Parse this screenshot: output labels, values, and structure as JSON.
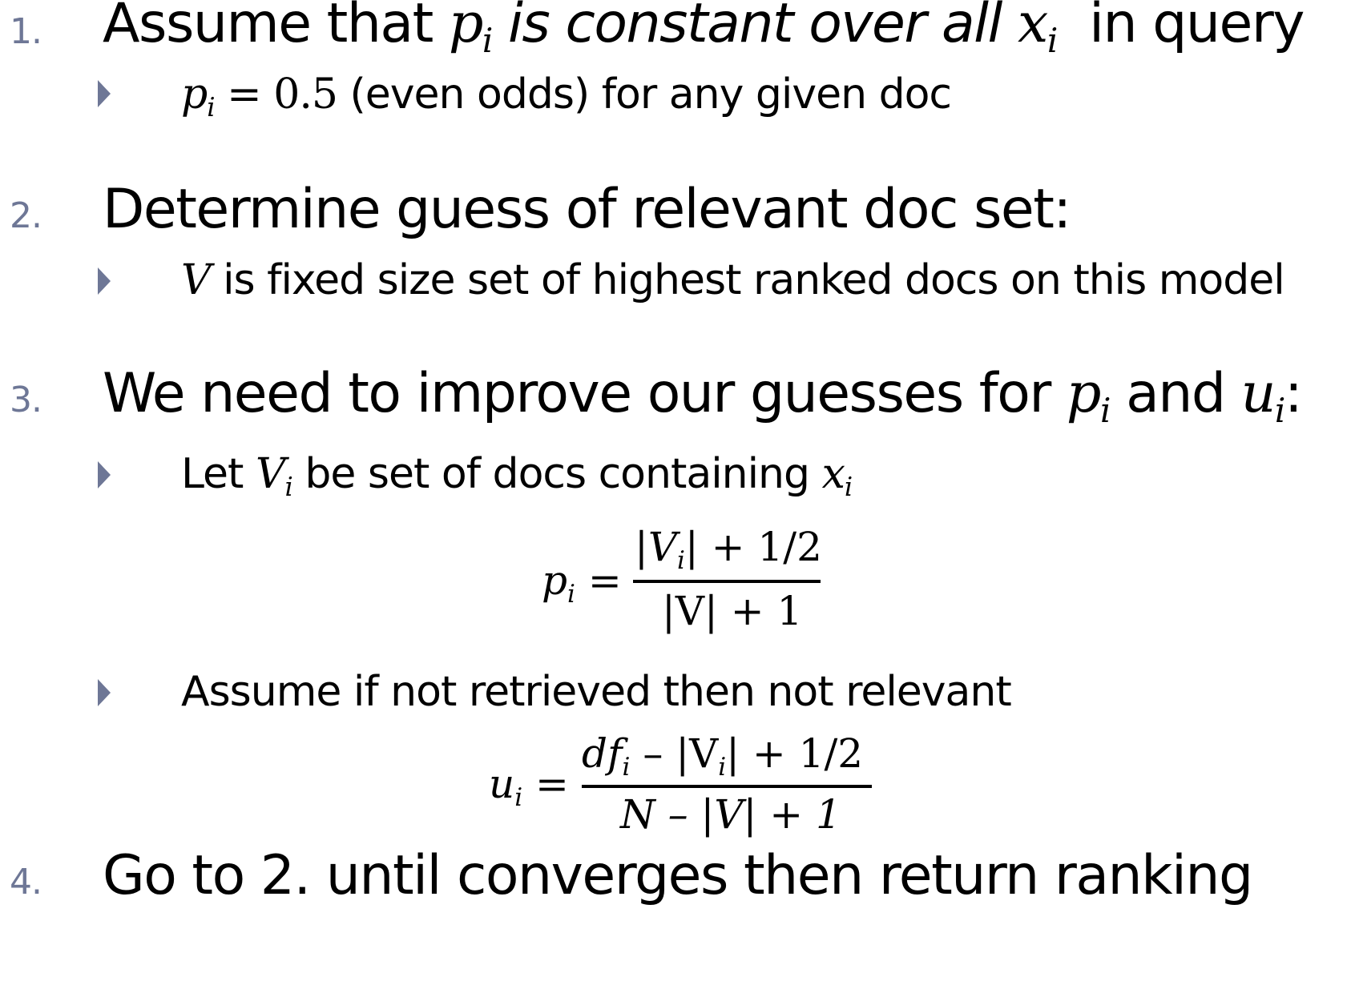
{
  "steps": [
    {
      "number": "1.",
      "text_a": "Assume that",
      "var_p": "p",
      "sub_i": "i",
      "text_b": "is constant over all",
      "var_x": "x",
      "text_c": "in query",
      "bullet": {
        "var_p": "p",
        "sub_i": "i",
        "eq": "= 0.5",
        "text": "(even odds) for any given doc"
      }
    },
    {
      "number": "2.",
      "text": "Determine guess of relevant doc set:",
      "bullet": {
        "var_v": "V",
        "text": "is fixed size set of highest ranked docs on this model"
      }
    },
    {
      "number": "3.",
      "text_a": "We need to improve our guesses for",
      "var_p": "p",
      "sub_i": "i",
      "text_b": "and",
      "var_u": "u",
      "text_c": ":",
      "bullet1": {
        "text_a": "Let",
        "var_v": "V",
        "sub_i": "i",
        "text_b": "be set of docs containing",
        "var_x": "x"
      },
      "formula1": {
        "lhs": "p",
        "sub": "i",
        "eq": "=",
        "num_a": "|V",
        "num_b": "| + 1/2",
        "den": "|V| + 1"
      },
      "bullet2": {
        "text": "Assume if not retrieved then not relevant"
      },
      "formula2": {
        "lhs": "u",
        "sub": "i",
        "eq": "=",
        "num_a": "df",
        "num_b": "– |V",
        "num_c": "| + 1/2",
        "den": "N – |V| + 1"
      }
    },
    {
      "number": "4.",
      "text": "Go to 2. until converges then return ranking"
    }
  ]
}
